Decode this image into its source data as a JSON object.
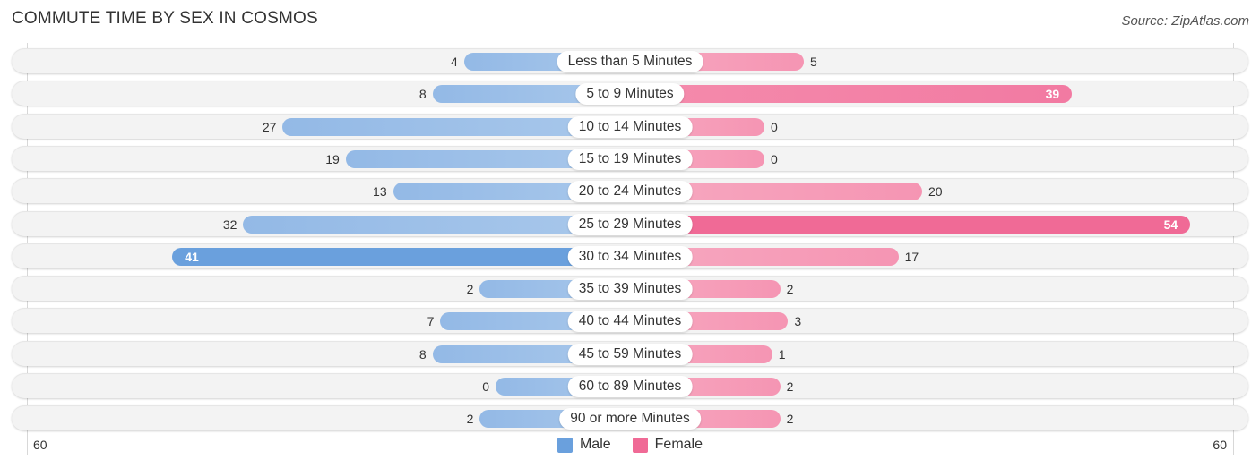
{
  "title": "COMMUTE TIME BY SEX IN COSMOS",
  "source": "Source: ZipAtlas.com",
  "axis": {
    "left_label": "60",
    "right_label": "60"
  },
  "legend": [
    {
      "name": "Male",
      "color": "#6aa0dd"
    },
    {
      "name": "Female",
      "color": "#f06a96"
    }
  ],
  "chart_data": {
    "type": "bar",
    "orientation": "horizontal-diverging",
    "title": "COMMUTE TIME BY SEX IN COSMOS",
    "xlabel": "",
    "ylabel": "",
    "xlim": [
      -60,
      60
    ],
    "legend_position": "bottom-center",
    "categories": [
      "Less than 5 Minutes",
      "5 to 9 Minutes",
      "10 to 14 Minutes",
      "15 to 19 Minutes",
      "20 to 24 Minutes",
      "25 to 29 Minutes",
      "30 to 34 Minutes",
      "35 to 39 Minutes",
      "40 to 44 Minutes",
      "45 to 59 Minutes",
      "60 to 89 Minutes",
      "90 or more Minutes"
    ],
    "series": [
      {
        "name": "Male",
        "color": "#6aa0dd",
        "values": [
          4,
          8,
          27,
          19,
          13,
          32,
          41,
          2,
          7,
          8,
          0,
          2
        ]
      },
      {
        "name": "Female",
        "color": "#f06a96",
        "values": [
          5,
          39,
          0,
          0,
          20,
          54,
          17,
          2,
          3,
          1,
          2,
          2
        ]
      }
    ]
  }
}
